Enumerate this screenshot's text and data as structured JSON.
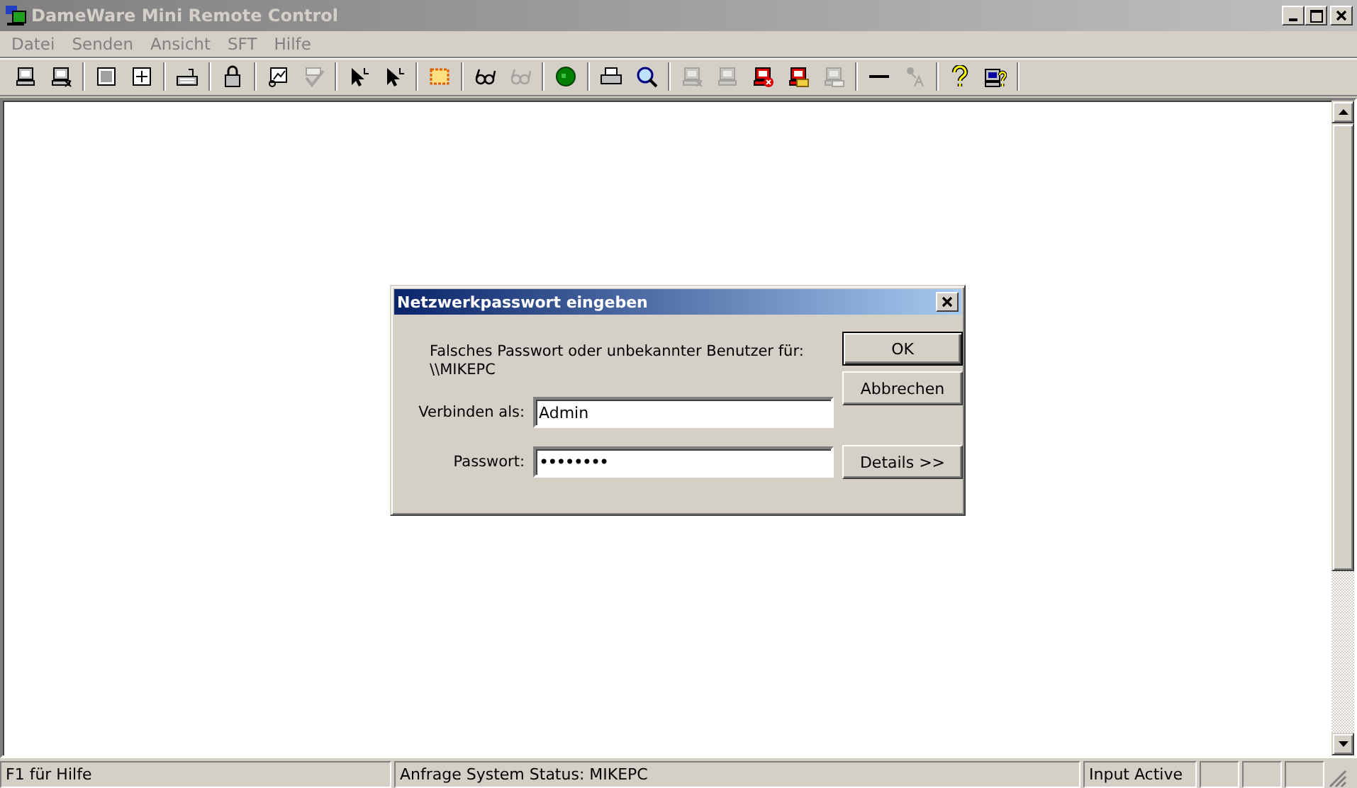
{
  "window": {
    "title": "DameWare Mini Remote Control",
    "active": false
  },
  "menu": [
    {
      "label": "Datei"
    },
    {
      "label": "Senden"
    },
    {
      "label": "Ansicht"
    },
    {
      "label": "SFT"
    },
    {
      "label": "Hilfe"
    }
  ],
  "toolbar": [
    [
      {
        "kind": "computer",
        "disabled": false
      },
      {
        "kind": "computer-off",
        "disabled": false
      }
    ],
    [
      {
        "kind": "grid",
        "disabled": false
      },
      {
        "kind": "move",
        "disabled": false
      }
    ],
    [
      {
        "kind": "keyboard",
        "disabled": false
      }
    ],
    [
      {
        "kind": "lock",
        "disabled": false
      }
    ],
    [
      {
        "kind": "chart",
        "disabled": false
      },
      {
        "kind": "check",
        "disabled": true
      }
    ],
    [
      {
        "kind": "cursor",
        "disabled": false
      },
      {
        "kind": "cursor",
        "disabled": false
      }
    ],
    [
      {
        "kind": "select",
        "disabled": false
      }
    ],
    [
      {
        "kind": "glasses",
        "disabled": false
      },
      {
        "kind": "glasses",
        "disabled": true
      }
    ],
    [
      {
        "kind": "globe",
        "disabled": false
      }
    ],
    [
      {
        "kind": "printer",
        "disabled": false
      },
      {
        "kind": "magnifier",
        "disabled": false
      }
    ],
    [
      {
        "kind": "computer-off",
        "disabled": true
      },
      {
        "kind": "computer",
        "disabled": true
      },
      {
        "kind": "computer-error",
        "disabled": false
      },
      {
        "kind": "computer-folder",
        "disabled": false
      },
      {
        "kind": "computer-keyboard",
        "disabled": true
      }
    ],
    [
      {
        "kind": "line",
        "disabled": false
      },
      {
        "kind": "font",
        "disabled": true
      }
    ],
    [
      {
        "kind": "help",
        "disabled": false
      },
      {
        "kind": "computer-help",
        "disabled": false
      }
    ]
  ],
  "dialog": {
    "title": "Netzwerkpasswort eingeben",
    "message": "Falsches Passwort oder unbekannter Benutzer für:",
    "target": "\\\\MIKEPC",
    "user_label": "Verbinden als:",
    "user_value": "Admin",
    "password_label": "Passwort:",
    "password_value": "••••••••",
    "buttons": [
      {
        "label": "OK",
        "default": true
      },
      {
        "label": "Abbrechen",
        "default": false
      },
      {
        "label": "Details >>",
        "default": false
      }
    ]
  },
  "status_bar": [
    {
      "kind": "text",
      "text": "F1 für Hilfe"
    },
    {
      "kind": "text",
      "text": "Anfrage System Status: MIKEPC"
    },
    {
      "kind": "text",
      "text": "Input Active"
    },
    {
      "kind": "blank"
    },
    {
      "kind": "blank"
    },
    {
      "kind": "blank"
    }
  ]
}
